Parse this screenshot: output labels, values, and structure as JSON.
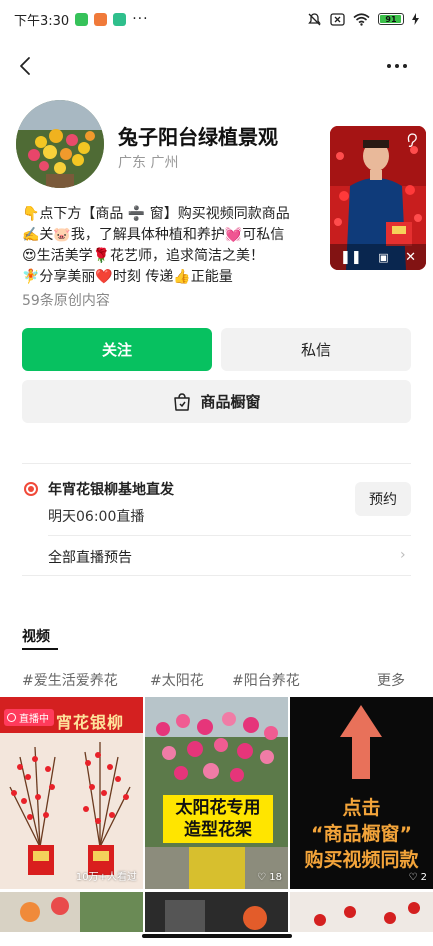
{
  "status_bar": {
    "time": "下午3:30",
    "battery": "91"
  },
  "profile": {
    "name": "兔子阳台绿植景观",
    "location": "广东 广州",
    "bio": [
      "👇点下方【商品 ➗ 窗】购买视频同款商品",
      "✍️关🐷我，了解具体种植和养护💓可私信",
      "😍生活美学🌹花艺师，追求简洁之美！",
      "🧚分享美丽❤️时刻 传递👍正能量"
    ],
    "post_count": "59条原创内容"
  },
  "actions": {
    "follow": "关注",
    "message": "私信",
    "shop": "商品橱窗"
  },
  "live_notice": {
    "title": "年宵花银柳基地直发",
    "time": "明天06:00直播",
    "reserve": "预约",
    "all_previews": "全部直播预告"
  },
  "tabs": {
    "videos": "视频"
  },
  "topics": {
    "items": [
      "#爱生活爱养花",
      "#太阳花",
      "#阳台养花"
    ],
    "more": "更多"
  },
  "grid": {
    "cell1": {
      "badge": "直播中",
      "banner": "宵花银柳",
      "views": "10万+人看过"
    },
    "cell2": {
      "caption_line1": "太阳花专用",
      "caption_line2": "造型花架",
      "likes": "18"
    },
    "cell3": {
      "line1": "点击",
      "line2": "“商品橱窗”",
      "line3": "购买视频同款",
      "likes": "2"
    }
  },
  "colors": {
    "follow_green": "#07c160",
    "live_red": "#f04a3a",
    "button_gray": "#f2f2f2"
  }
}
